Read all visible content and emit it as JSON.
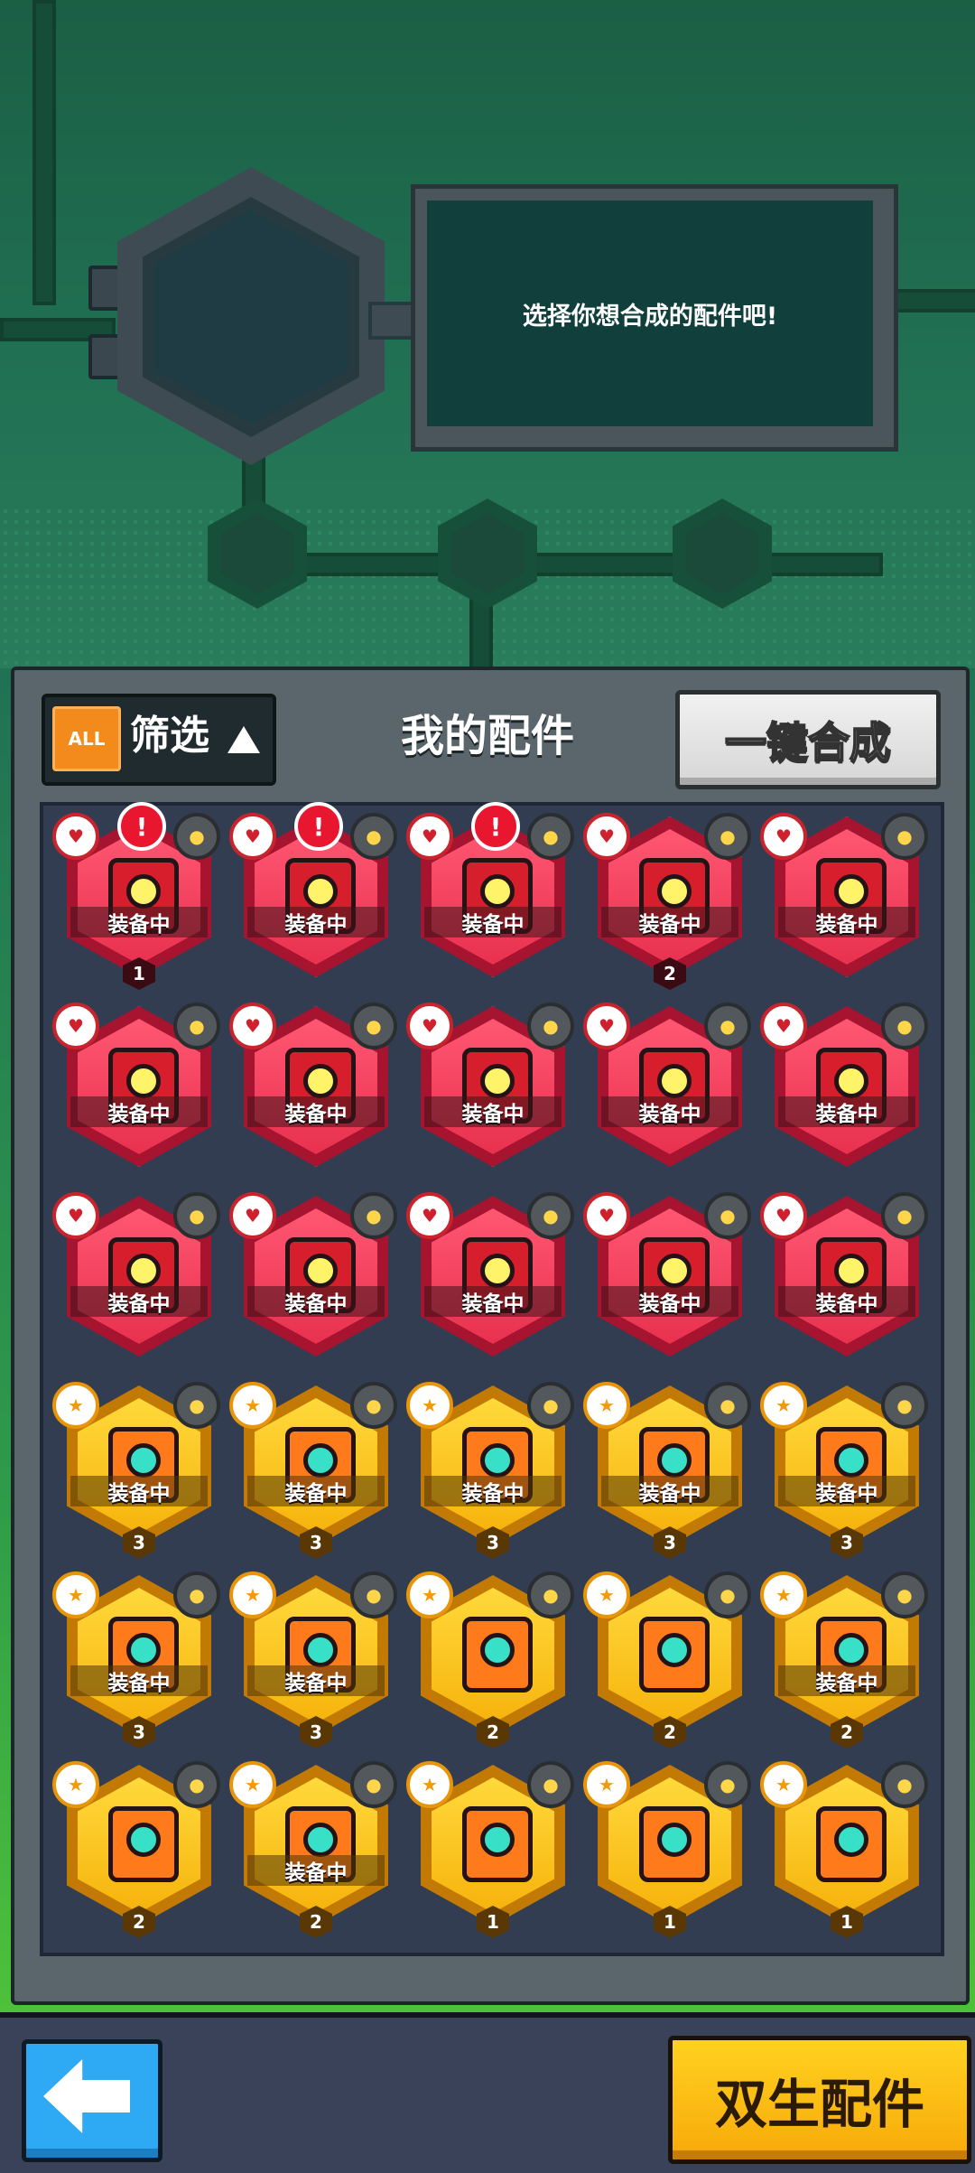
{
  "header": {
    "prompt_text": "选择你想合成的配件吧!"
  },
  "panel": {
    "filter_badge": "ALL",
    "filter_label": "筛选",
    "title": "我的配件",
    "merge_all_label": "一键合成"
  },
  "bottom": {
    "twin_label": "双生配件"
  },
  "items": [
    {
      "rarity": "red",
      "equipped_label": "装备中",
      "count": "1",
      "alert": "!",
      "glow": true
    },
    {
      "rarity": "red",
      "equipped_label": "装备中",
      "count": "",
      "alert": "!",
      "glow": true
    },
    {
      "rarity": "red",
      "equipped_label": "装备中",
      "count": "",
      "alert": "!",
      "glow": true
    },
    {
      "rarity": "red",
      "equipped_label": "装备中",
      "count": "2",
      "alert": "",
      "glow": true
    },
    {
      "rarity": "red",
      "equipped_label": "装备中",
      "count": "",
      "alert": "",
      "glow": true
    },
    {
      "rarity": "red",
      "equipped_label": "装备中",
      "count": "",
      "alert": "",
      "glow": true
    },
    {
      "rarity": "red",
      "equipped_label": "装备中",
      "count": "",
      "alert": "",
      "glow": true
    },
    {
      "rarity": "red",
      "equipped_label": "装备中",
      "count": "",
      "alert": "",
      "glow": true
    },
    {
      "rarity": "red",
      "equipped_label": "装备中",
      "count": "",
      "alert": "",
      "glow": false
    },
    {
      "rarity": "red",
      "equipped_label": "装备中",
      "count": "",
      "alert": "",
      "glow": false
    },
    {
      "rarity": "red",
      "equipped_label": "装备中",
      "count": "",
      "alert": "",
      "glow": false
    },
    {
      "rarity": "red",
      "equipped_label": "装备中",
      "count": "",
      "alert": "",
      "glow": false
    },
    {
      "rarity": "red",
      "equipped_label": "装备中",
      "count": "",
      "alert": "",
      "glow": false
    },
    {
      "rarity": "red",
      "equipped_label": "装备中",
      "count": "",
      "alert": "",
      "glow": false
    },
    {
      "rarity": "red",
      "equipped_label": "装备中",
      "count": "",
      "alert": "",
      "glow": false
    },
    {
      "rarity": "gold",
      "equipped_label": "装备中",
      "count": "3",
      "alert": "",
      "glow": false
    },
    {
      "rarity": "gold",
      "equipped_label": "装备中",
      "count": "3",
      "alert": "",
      "glow": false
    },
    {
      "rarity": "gold",
      "equipped_label": "装备中",
      "count": "3",
      "alert": "",
      "glow": false
    },
    {
      "rarity": "gold",
      "equipped_label": "装备中",
      "count": "3",
      "alert": "",
      "glow": false
    },
    {
      "rarity": "gold",
      "equipped_label": "装备中",
      "count": "3",
      "alert": "",
      "glow": false
    },
    {
      "rarity": "gold",
      "equipped_label": "装备中",
      "count": "3",
      "alert": "",
      "glow": false
    },
    {
      "rarity": "gold",
      "equipped_label": "装备中",
      "count": "3",
      "alert": "",
      "glow": false
    },
    {
      "rarity": "gold",
      "equipped_label": "",
      "count": "2",
      "alert": "",
      "glow": false
    },
    {
      "rarity": "gold",
      "equipped_label": "",
      "count": "2",
      "alert": "",
      "glow": false
    },
    {
      "rarity": "gold",
      "equipped_label": "装备中",
      "count": "2",
      "alert": "",
      "glow": false
    },
    {
      "rarity": "gold",
      "equipped_label": "",
      "count": "2",
      "alert": "",
      "glow": false
    },
    {
      "rarity": "gold",
      "equipped_label": "装备中",
      "count": "2",
      "alert": "",
      "glow": false
    },
    {
      "rarity": "gold",
      "equipped_label": "",
      "count": "1",
      "alert": "",
      "glow": false
    },
    {
      "rarity": "gold",
      "equipped_label": "",
      "count": "1",
      "alert": "",
      "glow": false
    },
    {
      "rarity": "gold",
      "equipped_label": "",
      "count": "1",
      "alert": "",
      "glow": false
    }
  ],
  "colors": {
    "red_part": "#e8314f",
    "gold_part": "#f6b30c",
    "back_button": "#2ea9f3",
    "twin_button": "#ffd21f"
  }
}
